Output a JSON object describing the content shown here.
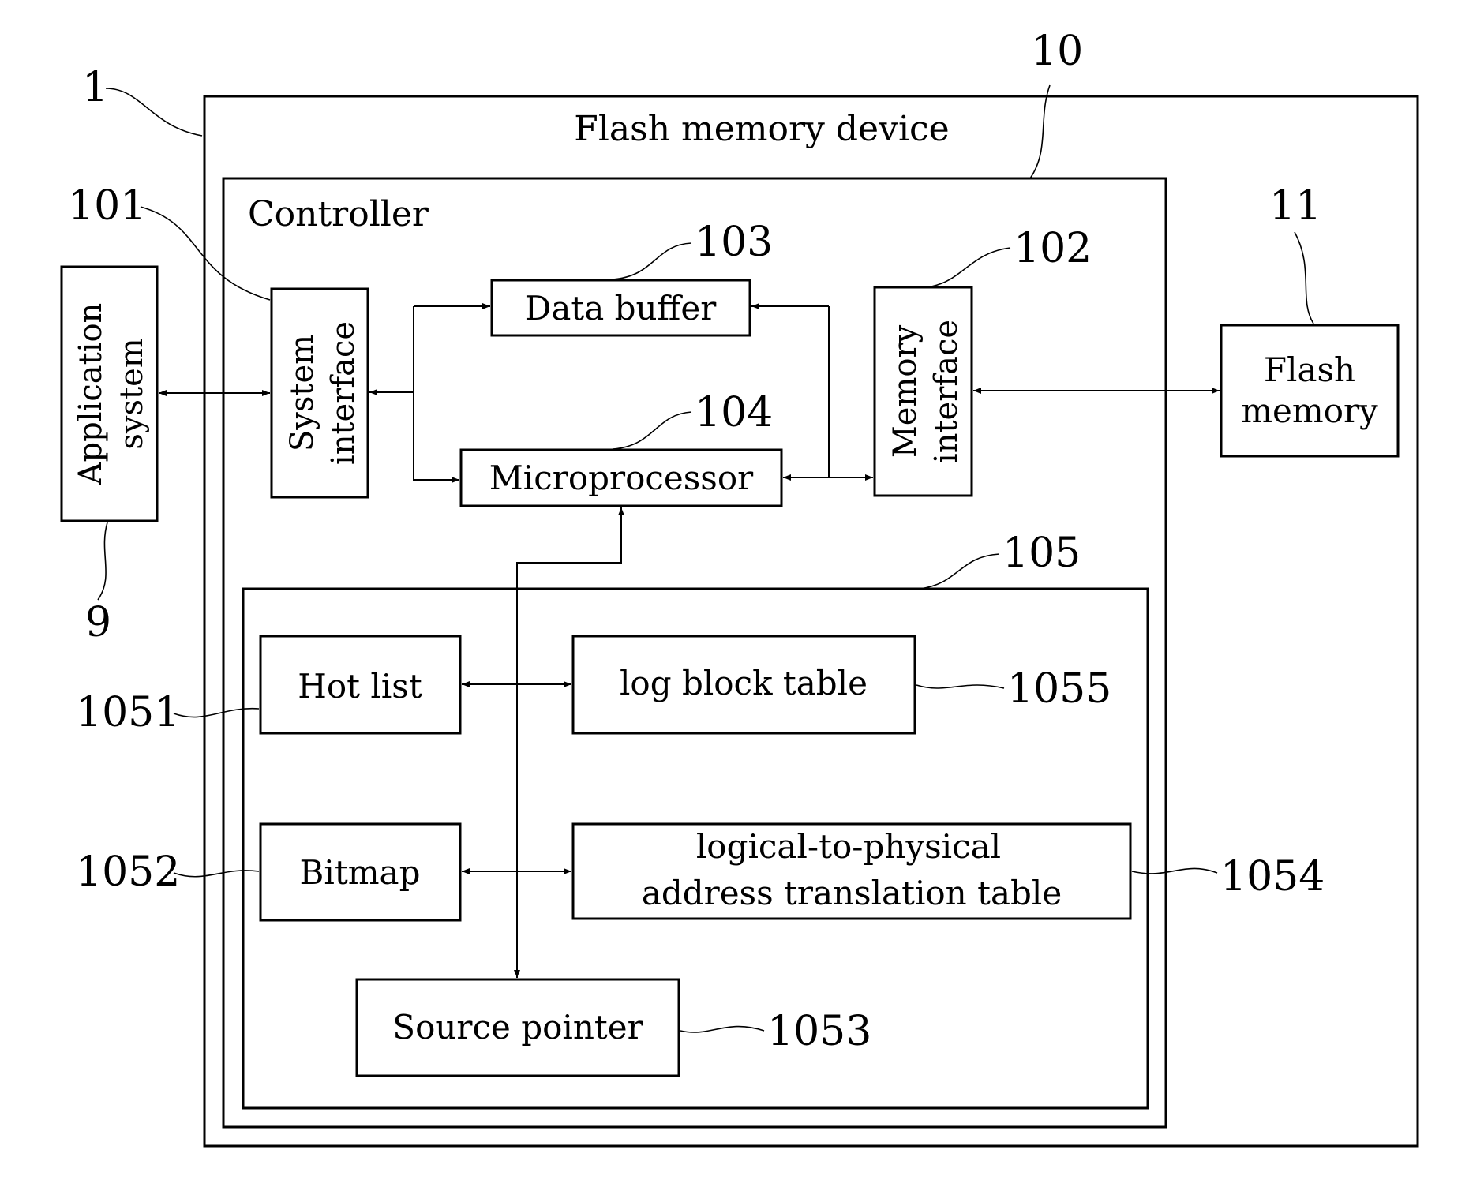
{
  "figure": {
    "outer_device": {
      "title": "Flash memory device",
      "ref": "1"
    },
    "controller": {
      "title": "Controller",
      "ref": "10"
    },
    "application_system": {
      "line1": "Application",
      "line2": "system",
      "ref": "9"
    },
    "system_interface": {
      "line1": "System",
      "line2": "interface",
      "ref": "101"
    },
    "memory_interface": {
      "line1": "Memory",
      "line2": "interface",
      "ref": "102"
    },
    "data_buffer": {
      "label": "Data buffer",
      "ref": "103"
    },
    "microprocessor": {
      "label": "Microprocessor",
      "ref": "104"
    },
    "memory_block": {
      "ref": "105"
    },
    "flash_memory": {
      "line1": "Flash",
      "line2": "memory",
      "ref": "11"
    },
    "hot_list": {
      "label": "Hot list",
      "ref": "1051"
    },
    "bitmap": {
      "label": "Bitmap",
      "ref": "1052"
    },
    "source_pointer": {
      "label": "Source pointer",
      "ref": "1053"
    },
    "l2p_table": {
      "line1": "logical-to-physical",
      "line2": "address translation table",
      "ref": "1054"
    },
    "log_block_table": {
      "label": "log block table",
      "ref": "1055"
    }
  }
}
